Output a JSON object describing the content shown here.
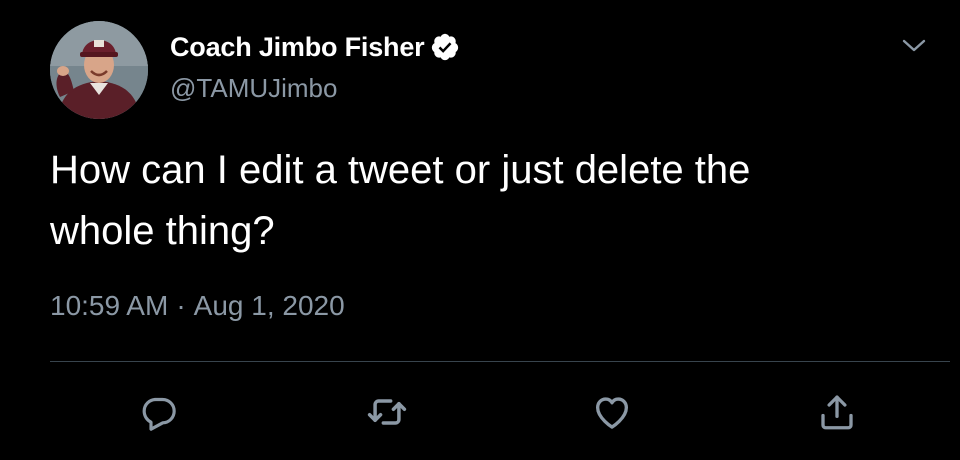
{
  "author": {
    "display_name": "Coach Jimbo Fisher",
    "handle": "@TAMUJimbo",
    "verified": true,
    "avatar_icon": "profile-photo"
  },
  "tweet": {
    "text": "How can I edit a tweet or just delete the\nwhole thing?",
    "time": "10:59 AM",
    "separator": "·",
    "date": "Aug 1, 2020"
  },
  "actions": {
    "reply_icon": "reply-icon",
    "retweet_icon": "retweet-icon",
    "like_icon": "heart-icon",
    "share_icon": "share-icon"
  },
  "colors": {
    "background": "#000000",
    "primary_text": "#ffffff",
    "secondary_text": "#8b98a5",
    "divider": "#38444d",
    "verified_badge": "#ffffff"
  }
}
